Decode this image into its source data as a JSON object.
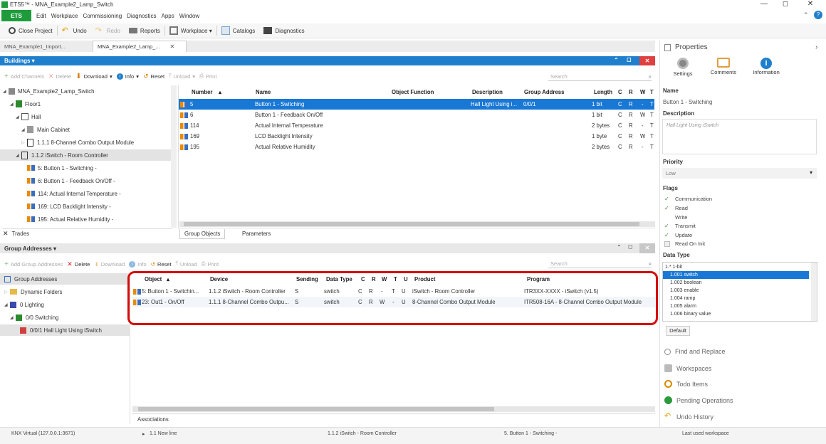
{
  "window": {
    "title": "ETS5™ - MNA_Example2_Lamp_Switch",
    "min": "—",
    "max": "◻",
    "close": "✕"
  },
  "menu": {
    "ets": "ETS",
    "items": [
      "Edit",
      "Workplace",
      "Commissioning",
      "Diagnostics",
      "Apps",
      "Window"
    ]
  },
  "toolbar": {
    "close_project": "Close Project",
    "undo": "Undo",
    "redo": "Redo",
    "reports": "Reports",
    "workplace": "Workplace ▾",
    "catalogs": "Catalogs",
    "diagnostics": "Diagnostics"
  },
  "doc_tabs": [
    {
      "label": "MNA_Example1_Import..."
    },
    {
      "label": "MNA_Example2_Lamp_...",
      "close": "✕"
    }
  ],
  "buildings": {
    "header": "Buildings ▾",
    "toolbar": {
      "add_channels": "Add Channels",
      "delete": "Delete",
      "download": "Download",
      "info": "Info",
      "reset": "Reset",
      "unload": "Unload",
      "print": "Print"
    },
    "search_placeholder": "Search",
    "tree": [
      {
        "label": "MNA_Example2_Lamp_Switch"
      },
      {
        "label": "Floor1"
      },
      {
        "label": "Hall"
      },
      {
        "label": "Main Cabinet"
      },
      {
        "label": "1.1.1 8-Channel Combo Output Module"
      },
      {
        "label": "1.1.2 iSwitch - Room Controller"
      },
      {
        "label": "5: Button 1 - Switching -"
      },
      {
        "label": "6: Button 1 - Feedback On/Off -"
      },
      {
        "label": "114: Actual Internal Temperature -"
      },
      {
        "label": "169: LCD Backlight Intensity -"
      },
      {
        "label": "195: Actual Relative Humidity -"
      }
    ],
    "trades": "Trades",
    "columns": [
      "Number",
      "Name",
      "Object Function",
      "Description",
      "Group Address",
      "Length",
      "C",
      "R",
      "W",
      "T"
    ],
    "rows": [
      {
        "number": "5",
        "name": "Button 1 - Switching",
        "func": "",
        "desc": "Hall Light Using i...",
        "ga": "0/0/1",
        "len": "1 bit",
        "c": "C",
        "r": "R",
        "w": "-",
        "t": "T"
      },
      {
        "number": "6",
        "name": "Button 1 - Feedback On/Off",
        "func": "",
        "desc": "",
        "ga": "",
        "len": "1 bit",
        "c": "C",
        "r": "R",
        "w": "W",
        "t": "T"
      },
      {
        "number": "114",
        "name": "Actual Internal Temperature",
        "func": "",
        "desc": "",
        "ga": "",
        "len": "2 bytes",
        "c": "C",
        "r": "R",
        "w": "-",
        "t": "T"
      },
      {
        "number": "169",
        "name": "LCD Backlight Intensity",
        "func": "",
        "desc": "",
        "ga": "",
        "len": "1 byte",
        "c": "C",
        "r": "R",
        "w": "W",
        "t": "T"
      },
      {
        "number": "195",
        "name": "Actual Relative Humidity",
        "func": "",
        "desc": "",
        "ga": "",
        "len": "2 bytes",
        "c": "C",
        "r": "R",
        "w": "-",
        "t": "T"
      }
    ],
    "bottom_tabs": [
      "Group Objects",
      "Parameters"
    ]
  },
  "group_addresses": {
    "header": "Group Addresses ▾",
    "toolbar": {
      "add": "Add Group Addresses",
      "delete": "Delete",
      "download": "Download",
      "info": "Info",
      "reset": "Reset",
      "unload": "Unload",
      "print": "Print"
    },
    "search_placeholder": "Search",
    "tree": [
      {
        "label": "Group Addresses"
      },
      {
        "label": "Dynamic Folders"
      },
      {
        "label": "0 Lighting"
      },
      {
        "label": "0/0 Switching"
      },
      {
        "label": "0/0/1 Hall Light Using iSwitch"
      }
    ],
    "columns": [
      "Object",
      "Device",
      "Sending",
      "Data Type",
      "C",
      "R",
      "W",
      "T",
      "U",
      "Product",
      "Program"
    ],
    "rows": [
      {
        "object": "5: Button 1 - Switchin...",
        "device": "1.1.2 iSwitch - Room Controller",
        "sending": "S",
        "dtype": "switch",
        "c": "C",
        "r": "R",
        "w": "-",
        "t": "T",
        "u": "U",
        "product": "iSwitch - Room Controller",
        "program": "ITR3XX-XXXX - iSwitch (v1.5)"
      },
      {
        "object": "23: Out1 - On/Off",
        "device": "1.1.1 8-Channel Combo Outpu...",
        "sending": "S",
        "dtype": "switch",
        "c": "C",
        "r": "R",
        "w": "W",
        "t": "-",
        "u": "U",
        "product": "8-Channel Combo Output Module",
        "program": "ITR508-16A - 8-Channel Combo Output Module"
      }
    ],
    "bottom_tab": "Associations"
  },
  "properties": {
    "title": "Properties",
    "tabs": [
      "Settings",
      "Comments",
      "Information"
    ],
    "name_label": "Name",
    "name_value": "Button 1 - Switching",
    "desc_label": "Description",
    "desc_value": "Hall Light Using iSwitch",
    "priority_label": "Priority",
    "priority_value": "Low",
    "flags_label": "Flags",
    "flags": [
      {
        "label": "Communication",
        "checked": true
      },
      {
        "label": "Read",
        "checked": true
      },
      {
        "label": "Write",
        "checked": false
      },
      {
        "label": "Transmit",
        "checked": true
      },
      {
        "label": "Update",
        "checked": true
      },
      {
        "label": "Read On Init",
        "checked": false
      }
    ],
    "datatype_label": "Data Type",
    "datatypes": [
      "1.* 1-bit",
      "1.001 switch",
      "1.002 boolean",
      "1.003 enable",
      "1.004 ramp",
      "1.005 alarm",
      "1.006 binary value"
    ],
    "default_btn": "Default",
    "links": [
      "Find and Replace",
      "Workspaces",
      "Todo Items",
      "Pending Operations",
      "Undo History"
    ]
  },
  "status": {
    "connection": "KNX Virtual  (127.0.0.1:3671)",
    "line": "1.1 New line",
    "device": "1.1.2 iSwitch - Room Controller",
    "object": "5. Button 1 - Switching -",
    "workspace": "Last used workspace"
  },
  "colors": {
    "accent": "#1f7fcc",
    "ets_green": "#1e9c3c",
    "selection": "#1978d6",
    "highlight": "#d60c0c"
  }
}
